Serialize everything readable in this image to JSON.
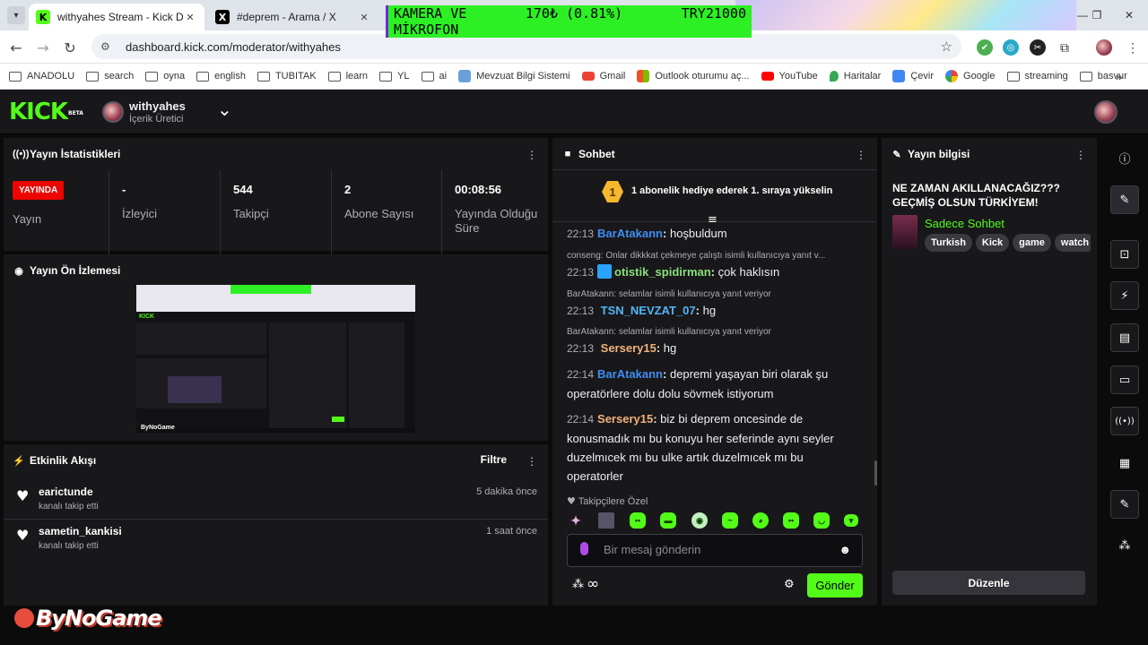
{
  "browser": {
    "tabs": [
      {
        "title": "withyahes Stream - Kick Dashbo",
        "active": true
      },
      {
        "title": "#deprem - Arama / X",
        "active": false
      }
    ],
    "ticker": {
      "line1_left": "KAMERA VE",
      "line1_mid": "170₺ (0.81%)",
      "line1_right": "TRY21000",
      "line2": "MİKROFON"
    },
    "url": "dashboard.kick.com/moderator/withyahes",
    "bookmarks": [
      "ANADOLU",
      "search",
      "oyna",
      "english",
      "TUBITAK",
      "learn",
      "YL",
      "ai",
      "Mevzuat Bilgi Sistemi",
      "Gmail",
      "Outlook oturumu aç...",
      "YouTube",
      "Haritalar",
      "Çevir",
      "Google",
      "streaming",
      "basvur"
    ],
    "overflow": "»"
  },
  "header": {
    "brand": "KICK",
    "beta": "BETA",
    "channel": "withyahes",
    "role": "İçerik Üretici",
    "expand": "⌄"
  },
  "stats": {
    "title": "Yayın İstatistikleri",
    "badge": "YAYINDA",
    "badge_label": "Yayın",
    "viewers_value": "-",
    "viewers_label": "İzleyici",
    "followers_value": "544",
    "followers_label": "Takipçi",
    "subs_value": "2",
    "subs_label": "Abone Sayısı",
    "uptime_value": "00:08:56",
    "uptime_label": "Yayında Olduğu Süre"
  },
  "preview": {
    "title": "Yayın Ön İzlemesi",
    "mini_brand": "KICK",
    "mini_watermark": "ByNoGame"
  },
  "activity": {
    "title": "Etkinlik Akışı",
    "filter": "Filtre",
    "items": [
      {
        "user": "earictunde",
        "desc": "kanalı takip etti",
        "time": "5 dakika önce"
      },
      {
        "user": "sametin_kankisi",
        "desc": "kanalı takip etti",
        "time": "1 saat önce"
      }
    ]
  },
  "chat": {
    "title": "Sohbet",
    "pin_badge": "1",
    "pin_text": "1 abonelik hediye ederek 1. sıraya yükselin",
    "messages": [
      {
        "time": "22:13",
        "user": "BarAtakann",
        "color": "#3f8ef0",
        "text": "hoşbuldum"
      },
      {
        "reply": "conseng: Onlar dikkkat çekmeye çalıştı isimli kullanıcıya yanıt v...",
        "time": "22:13",
        "user": "otistik_spidirman",
        "color": "#8ae07a",
        "text": "çok haklısın"
      },
      {
        "reply": "BarAtakann: selamlar isimli kullanıcıya yanıt veriyor",
        "time": "22:13",
        "user": "TSN_NEVZAT_07",
        "color": "#52b5f7",
        "text": "hg"
      },
      {
        "reply": "BarAtakann: selamlar isimli kullanıcıya yanıt veriyor",
        "time": "22:13",
        "user": "Sersery15",
        "color": "#f3b27a",
        "text": "hg"
      },
      {
        "time": "22:14",
        "user": "BarAtakann",
        "color": "#3f8ef0",
        "text": "depremi yaşayan biri olarak şu operatörlere dolu dolu sövmek istiyorum"
      },
      {
        "time": "22:14",
        "user": "Sersery15",
        "color": "#f3b27a",
        "text": "biz bi deprem oncesinde de konusmadık mı bu konuyu her seferinde aynı seyler duzelmıcek mı bu ulke artık duzelmıcek mı bu operatorler"
      }
    ],
    "followers_only": "Takipçilere Özel",
    "input_placeholder": "Bir mesaj gönderin",
    "infinity": "∞",
    "send": "Gönder"
  },
  "info": {
    "title": "Yayın bilgisi",
    "stream_title": "NE ZAMAN AKILLANACAĞIZ??? GEÇMİŞ OLSUN TÜRKİYEM!",
    "category": "Sadece Sohbet",
    "tags": [
      "Turkish",
      "Kick",
      "game",
      "watch"
    ],
    "edit": "Düzenle"
  },
  "watermark": "ByNoGame"
}
